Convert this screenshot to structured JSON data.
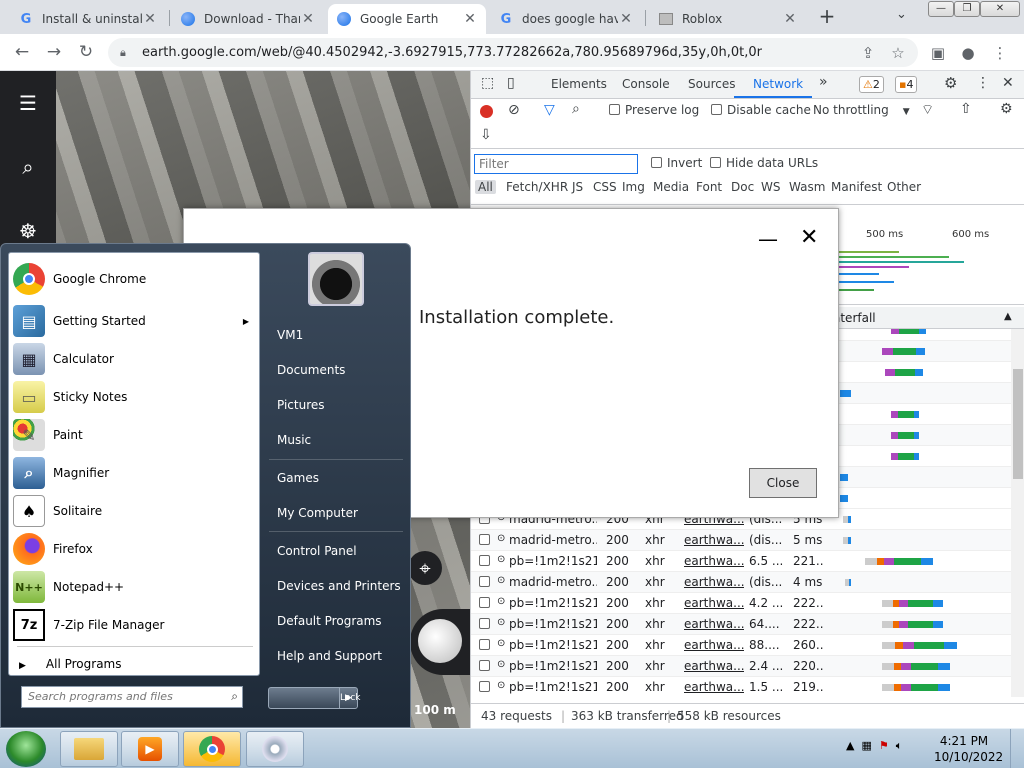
{
  "browser": {
    "tabs": [
      {
        "title": "Install & uninstall",
        "icon": "google-g-icon"
      },
      {
        "title": "Download - Thank",
        "icon": "google-earth-icon"
      },
      {
        "title": "Google Earth",
        "icon": "google-earth-icon",
        "active": true
      },
      {
        "title": "does google have",
        "icon": "google-g-icon"
      },
      {
        "title": "Roblox",
        "icon": "roblox-icon"
      }
    ],
    "url": "earth.google.com/web/@40.4502942,-3.6927915,773.77282662a,780.95689796d,35y,0h,0t,0r"
  },
  "earth": {
    "scale": "100 m"
  },
  "devtools": {
    "tabs": [
      "Elements",
      "Console",
      "Sources",
      "Network"
    ],
    "active_tab": "Network",
    "warnings": "2",
    "issues": "4",
    "preserve_log": "Preserve log",
    "disable_cache": "Disable cache",
    "throttling": "No throttling",
    "filter_placeholder": "Filter",
    "invert": "Invert",
    "hide_data_urls": "Hide data URLs",
    "types": [
      "All",
      "Fetch/XHR",
      "JS",
      "CSS",
      "Img",
      "Media",
      "Font",
      "Doc",
      "WS",
      "Wasm",
      "Manifest",
      "Other"
    ],
    "overview_labels": [
      "500 ms",
      "600 ms"
    ],
    "waterfall_header": "aterfall",
    "rows": [
      {
        "name": "madrid-metro...",
        "status": "200",
        "type": "xhr",
        "initiator": "earthwa...",
        "size": "(dis...",
        "time": "5 ms",
        "wf": [
          0.07,
          0.12
        ]
      },
      {
        "name": "madrid-metro...",
        "status": "200",
        "type": "xhr",
        "initiator": "earthwa...",
        "size": "(dis...",
        "time": "5 ms",
        "wf": [
          0.07,
          0.12
        ]
      },
      {
        "name": "pb=!1m2!1s21...",
        "status": "200",
        "type": "xhr",
        "initiator": "earthwa...",
        "size": "6.5 ...",
        "time": "221...",
        "wf": [
          0.2,
          0.6
        ]
      },
      {
        "name": "madrid-metro...",
        "status": "200",
        "type": "xhr",
        "initiator": "earthwa...",
        "size": "(dis...",
        "time": "4 ms",
        "wf": [
          0.08,
          0.12
        ]
      },
      {
        "name": "pb=!1m2!1s21...",
        "status": "200",
        "type": "xhr",
        "initiator": "earthwa...",
        "size": "4.2 ...",
        "time": "222...",
        "wf": [
          0.3,
          0.66
        ]
      },
      {
        "name": "pb=!1m2!1s21...",
        "status": "200",
        "type": "xhr",
        "initiator": "earthwa...",
        "size": "64....",
        "time": "222...",
        "wf": [
          0.3,
          0.66
        ]
      },
      {
        "name": "pb=!1m2!1s21...",
        "status": "200",
        "type": "xhr",
        "initiator": "earthwa...",
        "size": "88....",
        "time": "260...",
        "wf": [
          0.3,
          0.74
        ]
      },
      {
        "name": "pb=!1m2!1s21...",
        "status": "200",
        "type": "xhr",
        "initiator": "earthwa...",
        "size": "2.4 ...",
        "time": "220...",
        "wf": [
          0.3,
          0.7
        ]
      },
      {
        "name": "pb=!1m2!1s21...",
        "status": "200",
        "type": "xhr",
        "initiator": "earthwa...",
        "size": "1.5 ...",
        "time": "219...",
        "wf": [
          0.3,
          0.7
        ]
      }
    ],
    "status": {
      "requests": "43 requests",
      "transferred": "363 kB transferred",
      "resources": "558 kB resources"
    }
  },
  "dialog": {
    "message": "Installation complete.",
    "close_button": "Close"
  },
  "startmenu": {
    "programs": [
      {
        "label": "Google Chrome",
        "icon": "chrome-icon"
      },
      {
        "label": "Getting Started",
        "icon": "getting-started-icon",
        "submenu": true
      },
      {
        "label": "Calculator",
        "icon": "calculator-icon"
      },
      {
        "label": "Sticky Notes",
        "icon": "sticky-notes-icon"
      },
      {
        "label": "Paint",
        "icon": "paint-icon"
      },
      {
        "label": "Magnifier",
        "icon": "magnifier-icon"
      },
      {
        "label": "Solitaire",
        "icon": "solitaire-icon"
      },
      {
        "label": "Firefox",
        "icon": "firefox-icon"
      },
      {
        "label": "Notepad++",
        "icon": "notepadpp-icon"
      },
      {
        "label": "7-Zip File Manager",
        "icon": "7zip-icon"
      }
    ],
    "all_programs": "All Programs",
    "search_placeholder": "Search programs and files",
    "right": [
      "VM1",
      "Documents",
      "Pictures",
      "Music",
      "Games",
      "My Computer",
      "Control Panel",
      "Devices and Printers",
      "Default Programs",
      "Help and Support"
    ],
    "lock": "Lock"
  },
  "taskbar": {
    "time": "4:21 PM",
    "date": "10/10/2022"
  }
}
